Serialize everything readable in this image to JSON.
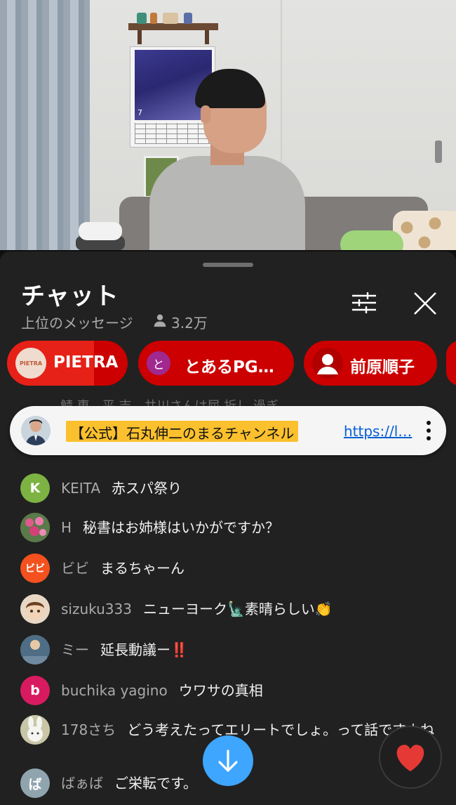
{
  "video": {
    "poster_number": "7"
  },
  "chat": {
    "title": "チャット",
    "mode": "上位のメッセージ",
    "viewer_count": "3.2万",
    "icons": {
      "filter": "filter-sliders-icon",
      "close": "close-icon",
      "viewers": "person-icon"
    }
  },
  "chips": [
    {
      "label": "PIETRA",
      "avatar_text": "PIETRA",
      "progress": 0.72
    },
    {
      "label": "とあるPG…",
      "avatar_text": "と",
      "progress": 0.0
    },
    {
      "label": "前原順子",
      "avatar_text": "",
      "progress": 0.0
    }
  ],
  "pinned": {
    "author": "【公式】石丸伸二のまるチャンネル",
    "link": "https://l…",
    "menu_icon": "more-vert-icon"
  },
  "behind_row": "鯖 恵　平 吉　井川さんは屈 折し 過ぎ",
  "messages": [
    {
      "author": "KEITA",
      "text": "赤スパ祭り",
      "avatar_text": "K",
      "avatar_color": "#7cb342"
    },
    {
      "author": "H",
      "text": "秘書はお姉様はいかがですか？",
      "avatar_text": "",
      "avatar_color": "#5a7a4a"
    },
    {
      "author": "ビビ",
      "text": "まるちゃーん",
      "avatar_text": "ビビ",
      "avatar_color": "#f4511e"
    },
    {
      "author": "sizuku333",
      "text": "ニューヨーク🗽素晴らしい👏",
      "avatar_text": "",
      "avatar_color": "#d8b89a"
    },
    {
      "author": "ミー",
      "text": "延長動議ー‼️",
      "avatar_text": "",
      "avatar_color": "#4f6e86"
    },
    {
      "author": "buchika yagino",
      "text": "ウワサの真相",
      "avatar_text": "b",
      "avatar_color": "#d81b60"
    },
    {
      "author": "178さち",
      "text": "どう考えたってエリートでしょ。って話ですよね",
      "avatar_text": "",
      "avatar_color": "#c9c6a8"
    },
    {
      "author": "ばぁば",
      "text": "ご栄転です。",
      "avatar_text": "ば",
      "avatar_color": "#90a4ae"
    }
  ],
  "buttons": {
    "scroll_down_icon": "arrow-down-icon",
    "heart_icon": "heart-icon",
    "heart_color": "#e53935"
  },
  "colors": {
    "accent": "#3ea6ff",
    "chip": "#cc0000",
    "pinned_highlight": "#fbc02d"
  }
}
